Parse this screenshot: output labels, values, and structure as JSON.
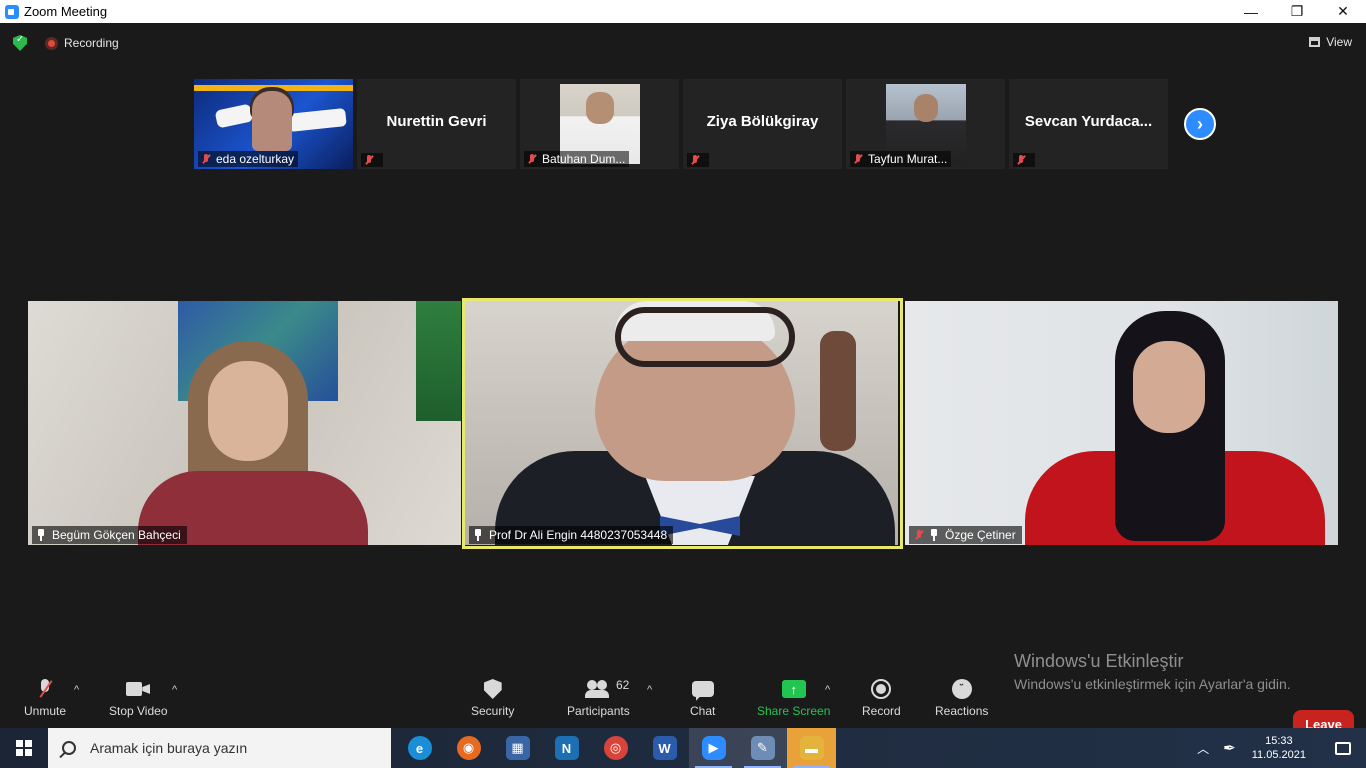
{
  "window": {
    "title": "Zoom Meeting",
    "controls": {
      "minimize": "—",
      "maximize": "❐",
      "close": "✕"
    }
  },
  "topbar": {
    "recording_label": "Recording",
    "view_label": "View"
  },
  "strip": {
    "tiles": [
      {
        "kind": "video",
        "name": "eda ozelturkay"
      },
      {
        "kind": "name",
        "display": "Nurettin Gevri"
      },
      {
        "kind": "video",
        "name": "Batuhan Dum..."
      },
      {
        "kind": "name",
        "display": "Ziya Bölükgiray"
      },
      {
        "kind": "video",
        "name": "Tayfun Murat..."
      },
      {
        "kind": "name",
        "display": "Sevcan  Yurdaca..."
      }
    ],
    "next_arrow": "›"
  },
  "gallery": {
    "tiles": [
      {
        "name": "Begüm Gökçen Bahçeci"
      },
      {
        "name": "Prof Dr Ali Engin 4480237053448",
        "active_speaker": true
      },
      {
        "name": "Özge Çetiner"
      }
    ],
    "active_speaker_color": "#e8e86a"
  },
  "toolbar": {
    "unmute": "Unmute",
    "stop_video": "Stop Video",
    "security": "Security",
    "participants": "Participants",
    "participant_count": "62",
    "chat": "Chat",
    "share_screen": "Share Screen",
    "record": "Record",
    "reactions": "Reactions",
    "leave": "Leave",
    "share_color": "#23c552",
    "leave_color": "#c8231f"
  },
  "watermark": {
    "title": "Windows'u Etkinleştir",
    "subtitle": "Windows'u etkinleştirmek için Ayarlar'a gidin."
  },
  "taskbar": {
    "search_placeholder": "Aramak için buraya yazın",
    "apps": [
      {
        "icon": "edge-icon",
        "glyph": "e",
        "color": "#1a8fd8"
      },
      {
        "icon": "firefox-icon",
        "glyph": "◉",
        "color": "#e66a1f"
      },
      {
        "icon": "calculator-icon",
        "glyph": "▦",
        "color": "#3a66a8"
      },
      {
        "icon": "nx-icon",
        "glyph": "N",
        "color": "#1d6fb3"
      },
      {
        "icon": "chrome-icon",
        "glyph": "◎",
        "color": "#d9443a"
      },
      {
        "icon": "word-icon",
        "glyph": "W",
        "color": "#2b5cab"
      },
      {
        "icon": "zoom-icon",
        "glyph": "▶",
        "color": "#2d8cff"
      },
      {
        "icon": "paint-icon",
        "glyph": "✎",
        "color": "#6d8db4"
      },
      {
        "icon": "file-explorer-icon",
        "glyph": "▬",
        "color": "#e3b33c"
      }
    ],
    "time": "15:33",
    "date": "11.05.2021"
  }
}
